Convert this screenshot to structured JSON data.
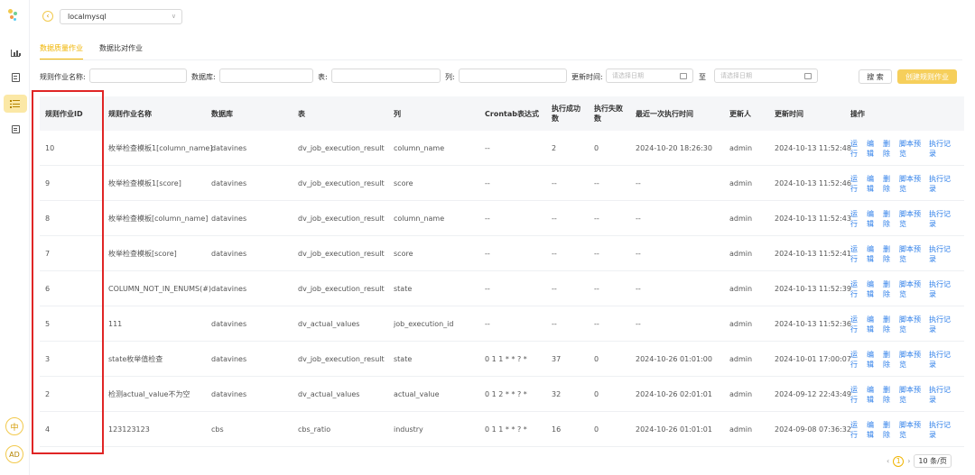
{
  "header": {
    "datasource": "localmysql"
  },
  "sidebar": {
    "lang_label": "中",
    "avatar_label": "AD"
  },
  "tabs": [
    {
      "label": "数据质量作业",
      "active": true
    },
    {
      "label": "数据比对作业",
      "active": false
    }
  ],
  "filters": {
    "job_name_label": "规则作业名称:",
    "database_label": "数据库:",
    "table_label": "表:",
    "column_label": "列:",
    "update_time_label": "更新时间:",
    "start_date_placeholder": "请选择日期",
    "to_label": "至",
    "end_date_placeholder": "请选择日期",
    "search_label": "搜 索",
    "create_label": "创建规则作业"
  },
  "table": {
    "headers": {
      "id": "规则作业ID",
      "name": "规则作业名称",
      "database": "数据库",
      "table": "表",
      "column": "列",
      "crontab": "Crontab表达式",
      "success": "执行成功数",
      "fail": "执行失败数",
      "last_exec": "最近一次执行时间",
      "updater": "更新人",
      "update_time": "更新时间",
      "ops": "操作"
    },
    "ops": [
      "运行",
      "编辑",
      "删除",
      "脚本预览",
      "执行记录"
    ],
    "rows": [
      {
        "id": "10",
        "name": "枚举检查模板1[column_name]",
        "database": "datavines",
        "table": "dv_job_execution_result",
        "column": "column_name",
        "crontab": "--",
        "success": "2",
        "fail": "0",
        "last_exec": "2024-10-20 18:26:30",
        "updater": "admin",
        "update_time": "2024-10-13 11:52:48"
      },
      {
        "id": "9",
        "name": "枚举检查模板1[score]",
        "database": "datavines",
        "table": "dv_job_execution_result",
        "column": "score",
        "crontab": "--",
        "success": "--",
        "fail": "--",
        "last_exec": "--",
        "updater": "admin",
        "update_time": "2024-10-13 11:52:46"
      },
      {
        "id": "8",
        "name": "枚举检查模板[column_name]",
        "database": "datavines",
        "table": "dv_job_execution_result",
        "column": "column_name",
        "crontab": "--",
        "success": "--",
        "fail": "--",
        "last_exec": "--",
        "updater": "admin",
        "update_time": "2024-10-13 11:52:43"
      },
      {
        "id": "7",
        "name": "枚举检查模板[score]",
        "database": "datavines",
        "table": "dv_job_execution_result",
        "column": "score",
        "crontab": "--",
        "success": "--",
        "fail": "--",
        "last_exec": "--",
        "updater": "admin",
        "update_time": "2024-10-13 11:52:41"
      },
      {
        "id": "6",
        "name": "COLUMN_NOT_IN_ENUMS(#)",
        "database": "datavines",
        "table": "dv_job_execution_result",
        "column": "state",
        "crontab": "--",
        "success": "--",
        "fail": "--",
        "last_exec": "--",
        "updater": "admin",
        "update_time": "2024-10-13 11:52:39"
      },
      {
        "id": "5",
        "name": "111",
        "database": "datavines",
        "table": "dv_actual_values",
        "column": "job_execution_id",
        "crontab": "--",
        "success": "--",
        "fail": "--",
        "last_exec": "--",
        "updater": "admin",
        "update_time": "2024-10-13 11:52:36"
      },
      {
        "id": "3",
        "name": "state枚举值检查",
        "database": "datavines",
        "table": "dv_job_execution_result",
        "column": "state",
        "crontab": "0 1 1 * * ? *",
        "success": "37",
        "fail": "0",
        "last_exec": "2024-10-26 01:01:00",
        "updater": "admin",
        "update_time": "2024-10-01 17:00:07"
      },
      {
        "id": "2",
        "name": "检测actual_value不为空",
        "database": "datavines",
        "table": "dv_actual_values",
        "column": "actual_value",
        "crontab": "0 1 2 * * ? *",
        "success": "32",
        "fail": "0",
        "last_exec": "2024-10-26 02:01:01",
        "updater": "admin",
        "update_time": "2024-09-12 22:43:49"
      },
      {
        "id": "4",
        "name": "123123123",
        "database": "cbs",
        "table": "cbs_ratio",
        "column": "industry",
        "crontab": "0 1 1 * * ? *",
        "success": "16",
        "fail": "0",
        "last_exec": "2024-10-26 01:01:01",
        "updater": "admin",
        "update_time": "2024-09-08 07:36:32"
      }
    ]
  },
  "pagination": {
    "current": "1",
    "page_size": "10 条/页"
  },
  "colors": {
    "accent": "#f0b400",
    "link": "#2b7de9",
    "highlight": "#e02525"
  }
}
